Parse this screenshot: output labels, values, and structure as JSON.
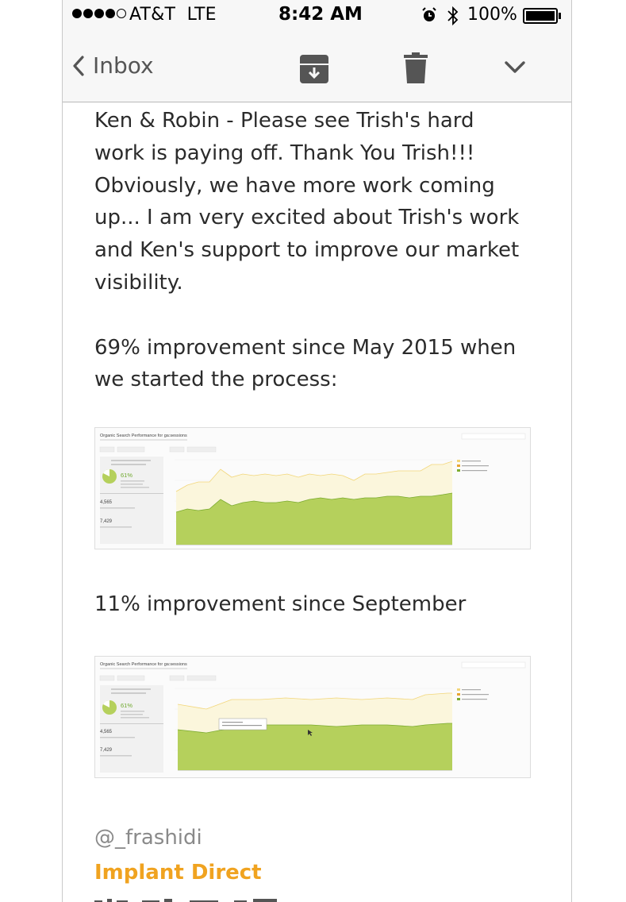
{
  "status_bar": {
    "carrier": "AT&T",
    "network": "LTE",
    "time": "8:42 AM",
    "battery": "100%",
    "icons": [
      "signal-dots-icon",
      "alarm-icon",
      "bluetooth-icon",
      "battery-icon"
    ]
  },
  "nav": {
    "back_label": "Inbox",
    "icons": [
      "back-chevron-icon",
      "archive-icon",
      "trash-icon",
      "chevron-down-icon"
    ]
  },
  "message": {
    "paragraph1": [
      "Ken & Robin - Please see Trish's hard",
      "work is paying off. Thank You Trish!!!",
      "Obviously, we have more work coming",
      "up... I am very excited about Trish's work",
      "and Ken's support to improve our market",
      "visibility."
    ],
    "paragraph2": [
      "69% improvement since May 2015 when",
      "we started the process:"
    ],
    "caption2": "11% improvement since September",
    "signature_handle": "@_frashidi",
    "signature_company": "Implant Direct"
  },
  "screenshot1": {
    "title": "Organic Search Performance for ga:sessions",
    "percent": "61%",
    "stat_a": "4,565",
    "stat_b": "7,429"
  },
  "screenshot2": {
    "title": "Organic Search Performance for ga:sessions",
    "percent": "61%",
    "stat_a": "4,565",
    "stat_b": "7,429"
  },
  "colors": {
    "accent": "#f0a320",
    "organic_fill": "#b5d05c",
    "total_fill": "#fbf6dc",
    "total_line": "#f2d67a"
  }
}
